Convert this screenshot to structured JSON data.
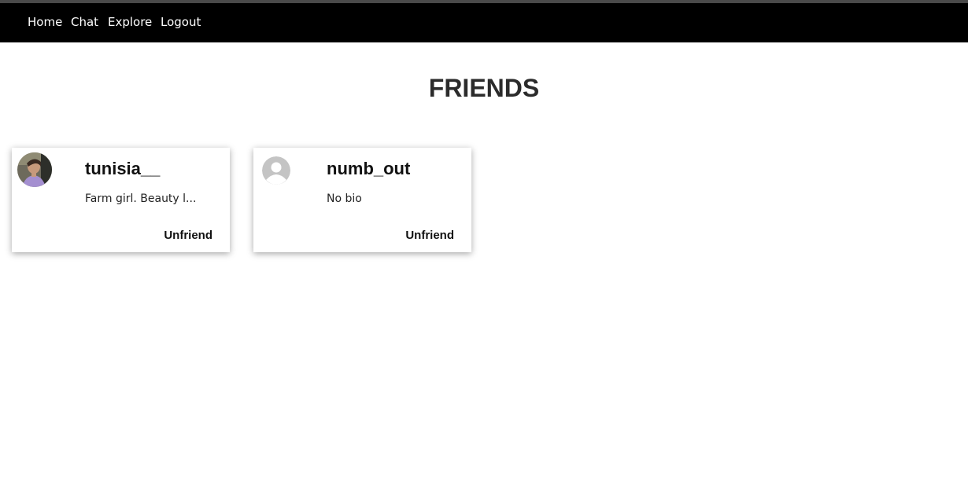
{
  "nav": {
    "links": [
      "Home",
      "Chat",
      "Explore",
      "Logout"
    ]
  },
  "page": {
    "title": "FRIENDS"
  },
  "friends": [
    {
      "username": "tunisia__",
      "bio": "Farm girl. Beauty l...",
      "action": "Unfriend",
      "avatar": "profile-photo"
    },
    {
      "username": "numb_out",
      "bio": "No bio",
      "action": "Unfriend",
      "avatar": "default-user-icon"
    }
  ],
  "colors": {
    "navbar": "#000000",
    "nav_text": "#ffffff",
    "title": "#2b2b2b",
    "default_avatar": "#c4c4c4"
  }
}
